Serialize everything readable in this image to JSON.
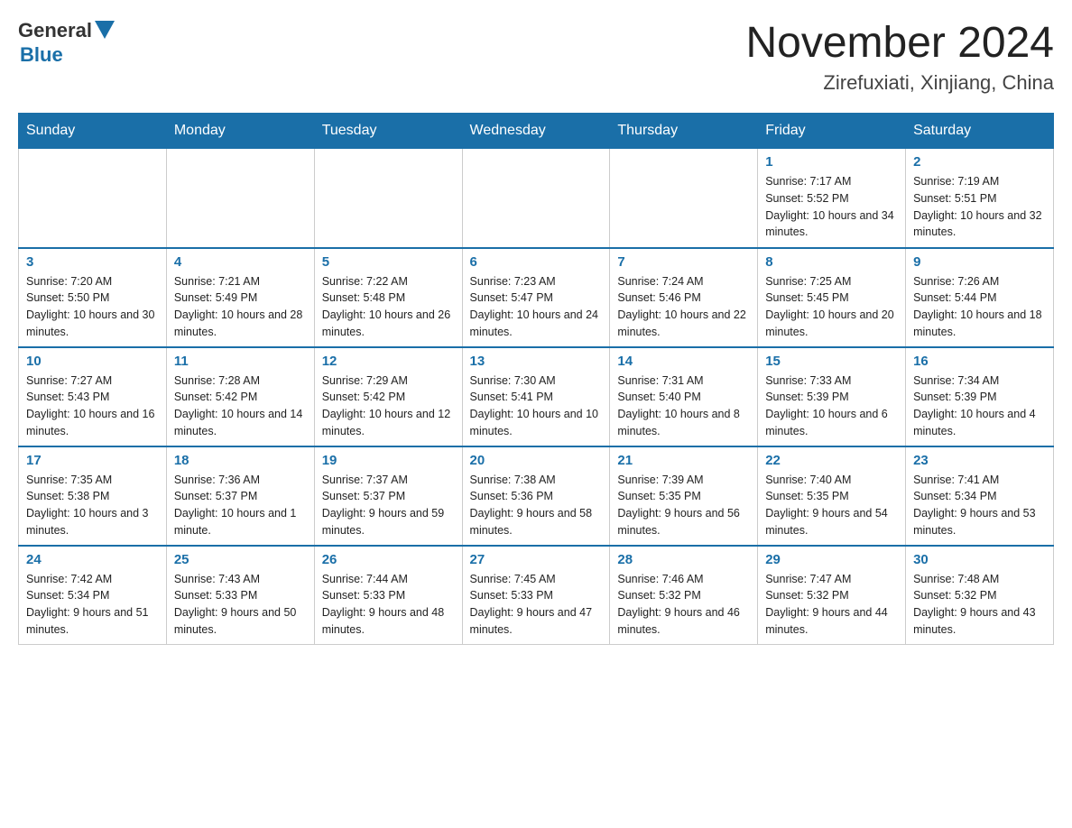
{
  "header": {
    "logo_general": "General",
    "logo_blue": "Blue",
    "month_title": "November 2024",
    "location": "Zirefuxiati, Xinjiang, China"
  },
  "weekdays": [
    "Sunday",
    "Monday",
    "Tuesday",
    "Wednesday",
    "Thursday",
    "Friday",
    "Saturday"
  ],
  "weeks": [
    [
      {
        "day": "",
        "sunrise": "",
        "sunset": "",
        "daylight": ""
      },
      {
        "day": "",
        "sunrise": "",
        "sunset": "",
        "daylight": ""
      },
      {
        "day": "",
        "sunrise": "",
        "sunset": "",
        "daylight": ""
      },
      {
        "day": "",
        "sunrise": "",
        "sunset": "",
        "daylight": ""
      },
      {
        "day": "",
        "sunrise": "",
        "sunset": "",
        "daylight": ""
      },
      {
        "day": "1",
        "sunrise": "Sunrise: 7:17 AM",
        "sunset": "Sunset: 5:52 PM",
        "daylight": "Daylight: 10 hours and 34 minutes."
      },
      {
        "day": "2",
        "sunrise": "Sunrise: 7:19 AM",
        "sunset": "Sunset: 5:51 PM",
        "daylight": "Daylight: 10 hours and 32 minutes."
      }
    ],
    [
      {
        "day": "3",
        "sunrise": "Sunrise: 7:20 AM",
        "sunset": "Sunset: 5:50 PM",
        "daylight": "Daylight: 10 hours and 30 minutes."
      },
      {
        "day": "4",
        "sunrise": "Sunrise: 7:21 AM",
        "sunset": "Sunset: 5:49 PM",
        "daylight": "Daylight: 10 hours and 28 minutes."
      },
      {
        "day": "5",
        "sunrise": "Sunrise: 7:22 AM",
        "sunset": "Sunset: 5:48 PM",
        "daylight": "Daylight: 10 hours and 26 minutes."
      },
      {
        "day": "6",
        "sunrise": "Sunrise: 7:23 AM",
        "sunset": "Sunset: 5:47 PM",
        "daylight": "Daylight: 10 hours and 24 minutes."
      },
      {
        "day": "7",
        "sunrise": "Sunrise: 7:24 AM",
        "sunset": "Sunset: 5:46 PM",
        "daylight": "Daylight: 10 hours and 22 minutes."
      },
      {
        "day": "8",
        "sunrise": "Sunrise: 7:25 AM",
        "sunset": "Sunset: 5:45 PM",
        "daylight": "Daylight: 10 hours and 20 minutes."
      },
      {
        "day": "9",
        "sunrise": "Sunrise: 7:26 AM",
        "sunset": "Sunset: 5:44 PM",
        "daylight": "Daylight: 10 hours and 18 minutes."
      }
    ],
    [
      {
        "day": "10",
        "sunrise": "Sunrise: 7:27 AM",
        "sunset": "Sunset: 5:43 PM",
        "daylight": "Daylight: 10 hours and 16 minutes."
      },
      {
        "day": "11",
        "sunrise": "Sunrise: 7:28 AM",
        "sunset": "Sunset: 5:42 PM",
        "daylight": "Daylight: 10 hours and 14 minutes."
      },
      {
        "day": "12",
        "sunrise": "Sunrise: 7:29 AM",
        "sunset": "Sunset: 5:42 PM",
        "daylight": "Daylight: 10 hours and 12 minutes."
      },
      {
        "day": "13",
        "sunrise": "Sunrise: 7:30 AM",
        "sunset": "Sunset: 5:41 PM",
        "daylight": "Daylight: 10 hours and 10 minutes."
      },
      {
        "day": "14",
        "sunrise": "Sunrise: 7:31 AM",
        "sunset": "Sunset: 5:40 PM",
        "daylight": "Daylight: 10 hours and 8 minutes."
      },
      {
        "day": "15",
        "sunrise": "Sunrise: 7:33 AM",
        "sunset": "Sunset: 5:39 PM",
        "daylight": "Daylight: 10 hours and 6 minutes."
      },
      {
        "day": "16",
        "sunrise": "Sunrise: 7:34 AM",
        "sunset": "Sunset: 5:39 PM",
        "daylight": "Daylight: 10 hours and 4 minutes."
      }
    ],
    [
      {
        "day": "17",
        "sunrise": "Sunrise: 7:35 AM",
        "sunset": "Sunset: 5:38 PM",
        "daylight": "Daylight: 10 hours and 3 minutes."
      },
      {
        "day": "18",
        "sunrise": "Sunrise: 7:36 AM",
        "sunset": "Sunset: 5:37 PM",
        "daylight": "Daylight: 10 hours and 1 minute."
      },
      {
        "day": "19",
        "sunrise": "Sunrise: 7:37 AM",
        "sunset": "Sunset: 5:37 PM",
        "daylight": "Daylight: 9 hours and 59 minutes."
      },
      {
        "day": "20",
        "sunrise": "Sunrise: 7:38 AM",
        "sunset": "Sunset: 5:36 PM",
        "daylight": "Daylight: 9 hours and 58 minutes."
      },
      {
        "day": "21",
        "sunrise": "Sunrise: 7:39 AM",
        "sunset": "Sunset: 5:35 PM",
        "daylight": "Daylight: 9 hours and 56 minutes."
      },
      {
        "day": "22",
        "sunrise": "Sunrise: 7:40 AM",
        "sunset": "Sunset: 5:35 PM",
        "daylight": "Daylight: 9 hours and 54 minutes."
      },
      {
        "day": "23",
        "sunrise": "Sunrise: 7:41 AM",
        "sunset": "Sunset: 5:34 PM",
        "daylight": "Daylight: 9 hours and 53 minutes."
      }
    ],
    [
      {
        "day": "24",
        "sunrise": "Sunrise: 7:42 AM",
        "sunset": "Sunset: 5:34 PM",
        "daylight": "Daylight: 9 hours and 51 minutes."
      },
      {
        "day": "25",
        "sunrise": "Sunrise: 7:43 AM",
        "sunset": "Sunset: 5:33 PM",
        "daylight": "Daylight: 9 hours and 50 minutes."
      },
      {
        "day": "26",
        "sunrise": "Sunrise: 7:44 AM",
        "sunset": "Sunset: 5:33 PM",
        "daylight": "Daylight: 9 hours and 48 minutes."
      },
      {
        "day": "27",
        "sunrise": "Sunrise: 7:45 AM",
        "sunset": "Sunset: 5:33 PM",
        "daylight": "Daylight: 9 hours and 47 minutes."
      },
      {
        "day": "28",
        "sunrise": "Sunrise: 7:46 AM",
        "sunset": "Sunset: 5:32 PM",
        "daylight": "Daylight: 9 hours and 46 minutes."
      },
      {
        "day": "29",
        "sunrise": "Sunrise: 7:47 AM",
        "sunset": "Sunset: 5:32 PM",
        "daylight": "Daylight: 9 hours and 44 minutes."
      },
      {
        "day": "30",
        "sunrise": "Sunrise: 7:48 AM",
        "sunset": "Sunset: 5:32 PM",
        "daylight": "Daylight: 9 hours and 43 minutes."
      }
    ]
  ]
}
